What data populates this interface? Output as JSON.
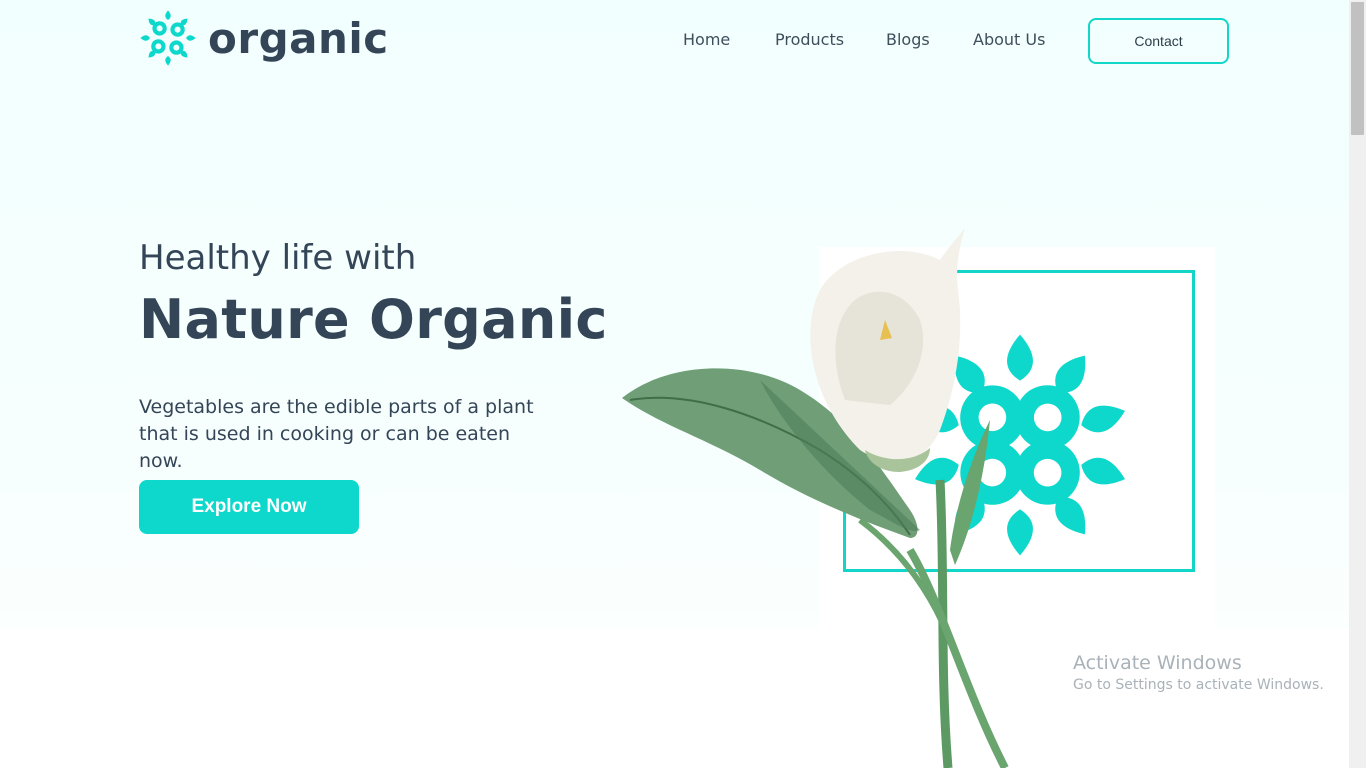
{
  "brand": {
    "name": "organic",
    "accent": "#0dd8cb",
    "text_color": "#344557"
  },
  "nav": {
    "items": [
      {
        "label": "Home"
      },
      {
        "label": "Products"
      },
      {
        "label": "Blogs"
      },
      {
        "label": "About Us"
      }
    ],
    "contact_label": "Contact"
  },
  "hero": {
    "subtitle": "Healthy life with",
    "title": "Nature Organic",
    "description": "Vegetables are the edible parts of a plant that is used in cooking or can be eaten now.",
    "cta_label": "Explore Now"
  },
  "illustration": {
    "icons": [
      "mandala-logo-icon",
      "calla-lily-flower"
    ]
  },
  "watermark": {
    "title": "Activate Windows",
    "subtitle": "Go to Settings to activate Windows."
  }
}
